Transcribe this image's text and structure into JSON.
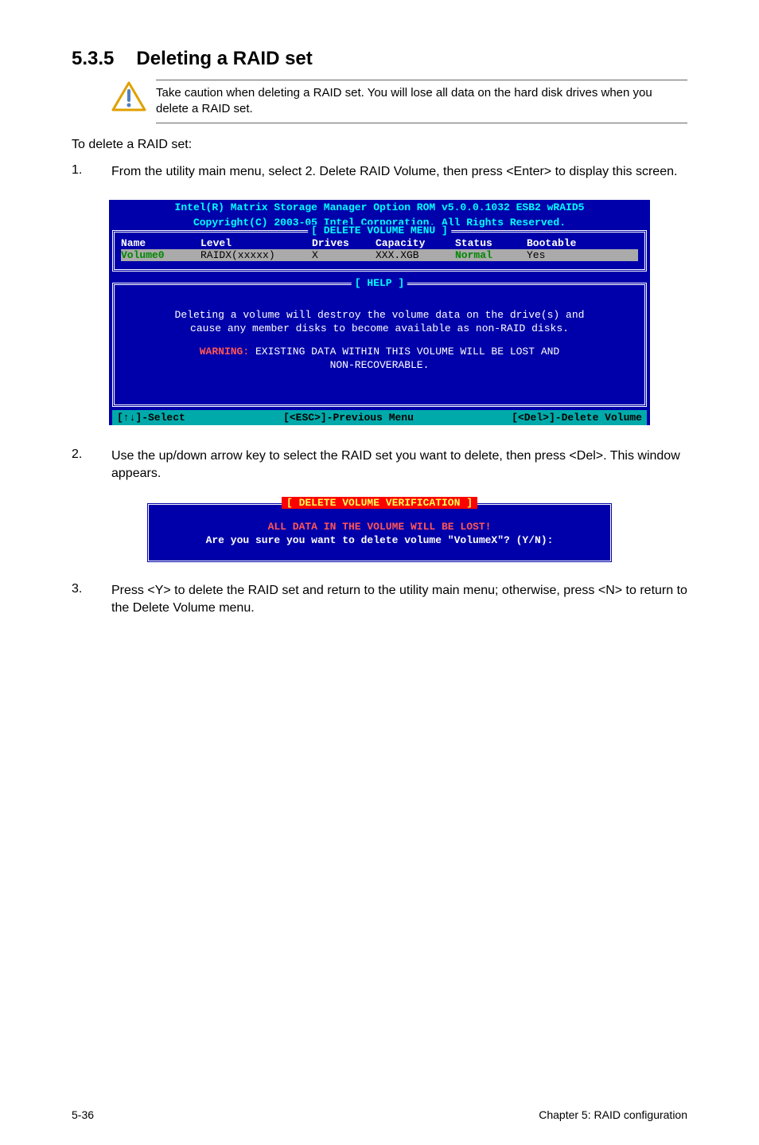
{
  "heading": {
    "number": "5.3.5",
    "title": "Deleting a RAID set"
  },
  "caution": "Take caution when deleting a RAID set. You will lose all data on the hard disk drives when you delete a RAID set.",
  "intro": "To delete a RAID set:",
  "steps": {
    "s1": {
      "num": "1.",
      "text": "From the utility main menu, select 2. Delete RAID Volume, then press <Enter> to display this screen."
    },
    "s2": {
      "num": "2.",
      "text": "Use the up/down arrow key to select the RAID set you want to delete, then press <Del>. This window appears."
    },
    "s3": {
      "num": "3.",
      "text": "Press <Y> to delete the RAID set and return to the utility main menu; otherwise, press <N> to return to the Delete Volume menu."
    }
  },
  "bios_header": {
    "line1": "Intel(R) Matrix Storage Manager Option ROM v5.0.0.1032 ESB2 wRAID5",
    "line2": "Copyright(C) 2003-05 Intel Corporation. All Rights Reserved."
  },
  "delete_menu": {
    "title": "[ DELETE VOLUME MENU ]",
    "headers": {
      "name": "Name",
      "level": "Level",
      "drives": "Drives",
      "capacity": "Capacity",
      "status": "Status",
      "bootable": "Bootable"
    },
    "row": {
      "name": "Volume0",
      "level": "RAIDX(xxxxx)",
      "drives": "X",
      "capacity": "XXX.XGB",
      "status": "Normal",
      "bootable": "Yes"
    }
  },
  "help_box": {
    "title": "[ HELP ]",
    "line1": "Deleting a volume will destroy the volume data on the drive(s) and",
    "line2": "cause any member disks to become available as non-RAID disks.",
    "warn_prefix": "WARNING:",
    "warn_rest": " EXISTING DATA WITHIN THIS VOLUME WILL BE LOST AND",
    "warn_line2": "NON-RECOVERABLE."
  },
  "bios_footer": {
    "left": "[↑↓]-Select",
    "mid": "[<ESC>]-Previous Menu",
    "right": "[<Del>]-Delete Volume"
  },
  "verify": {
    "title": "[ DELETE VOLUME VERIFICATION ]",
    "redline": "ALL DATA IN THE VOLUME WILL BE LOST!",
    "prompt": "Are you sure you want to delete volume \"VolumeX\"? (Y/N):"
  },
  "footer": {
    "left": "5-36",
    "right": "Chapter 5: RAID configuration"
  }
}
